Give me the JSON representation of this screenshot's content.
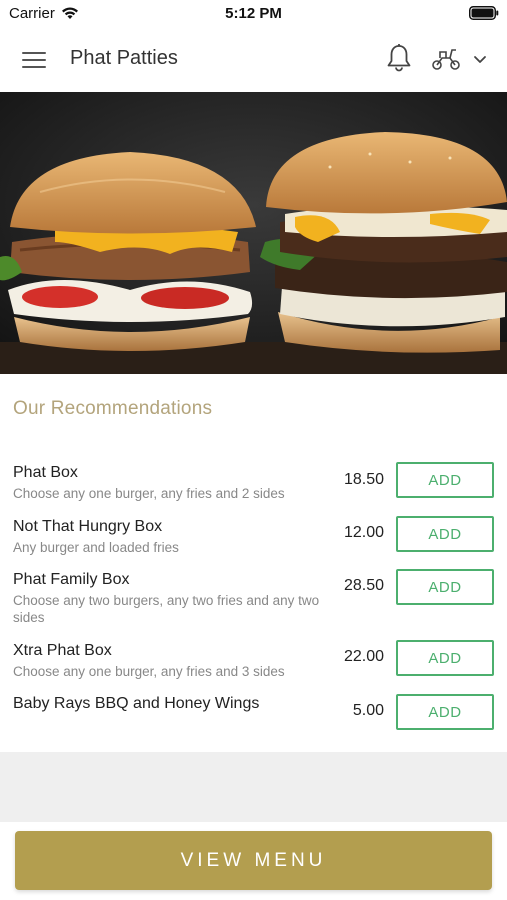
{
  "status_bar": {
    "carrier": "Carrier",
    "time": "5:12 PM"
  },
  "header": {
    "title": "Phat Patties"
  },
  "icons": {
    "menu": "hamburger-icon",
    "bell": "bell-icon",
    "delivery": "scooter-icon",
    "expand": "chevron-down-icon"
  },
  "recommendations": {
    "title": "Our Recommendations",
    "items": [
      {
        "name": "Phat Box",
        "description": "Choose any one burger, any fries and 2 sides",
        "price": "18.50",
        "button": "ADD"
      },
      {
        "name": "Not That Hungry Box",
        "description": "Any burger and loaded fries",
        "price": "12.00",
        "button": "ADD"
      },
      {
        "name": "Phat Family Box",
        "description": "Choose any two burgers, any two fries and any two sides",
        "price": "28.50",
        "button": "ADD"
      },
      {
        "name": "Xtra Phat Box",
        "description": "Choose any one burger, any fries and 3 sides",
        "price": "22.00",
        "button": "ADD"
      },
      {
        "name": "Baby Rays BBQ and Honey Wings",
        "description": "",
        "price": "5.00",
        "button": "ADD"
      }
    ]
  },
  "footer": {
    "view_menu_label": "VIEW MENU"
  },
  "colors": {
    "accent_gold": "#b39e4f",
    "title_gold": "#b3a47c",
    "add_green": "#4caf6e"
  }
}
